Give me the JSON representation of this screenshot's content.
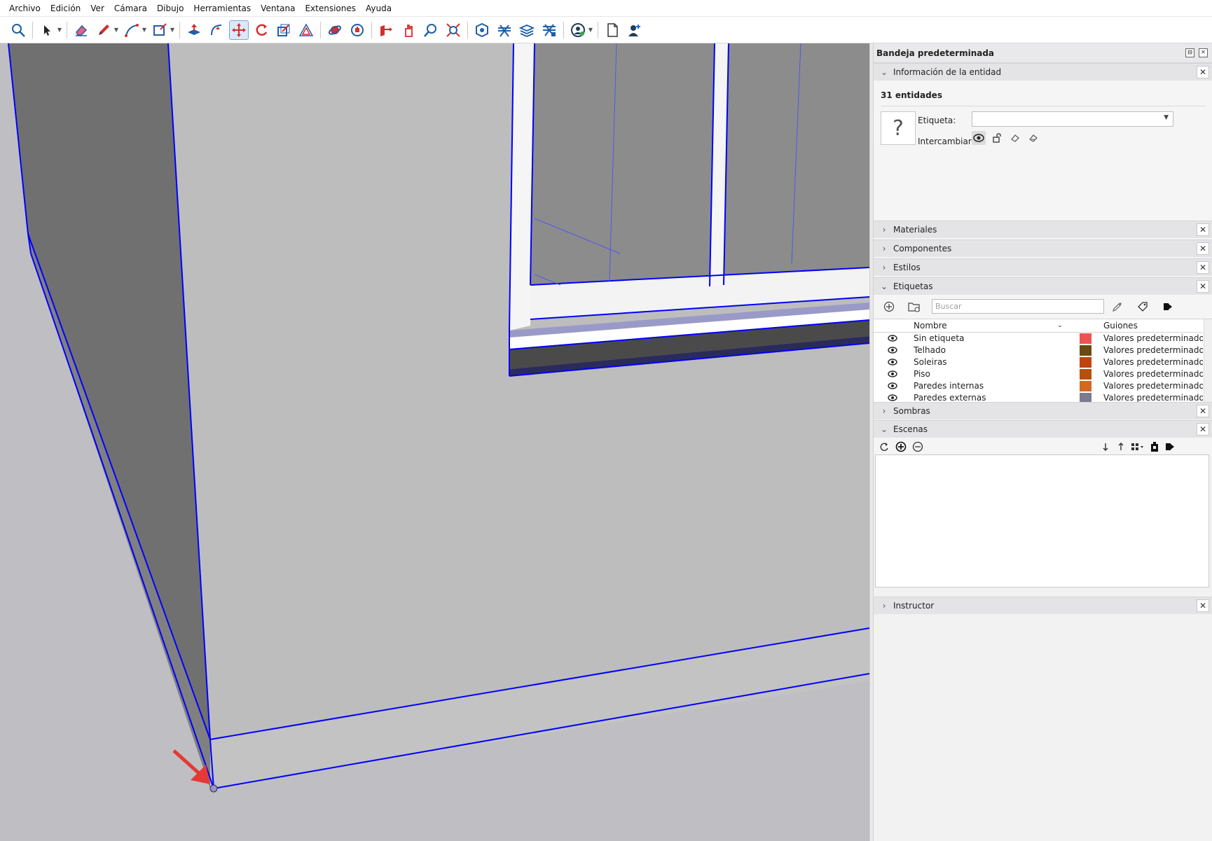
{
  "menu": [
    "Archivo",
    "Edición",
    "Ver",
    "Cámara",
    "Dibujo",
    "Herramientas",
    "Ventana",
    "Extensiones",
    "Ayuda"
  ],
  "toolbar_icons": [
    "search-icon",
    "select-icon",
    "eraser-icon",
    "pencil-icon",
    "arc-icon",
    "rectangle-icon",
    "push-pull-icon",
    "follow-me-icon",
    "move-icon",
    "rotate-icon",
    "scale-icon",
    "offset-icon",
    "orbit-icon",
    "pan-icon",
    "section-plane-icon",
    "walk-icon",
    "zoom-icon",
    "zoom-extents-icon",
    "solid-tools-icon",
    "sandbox-icon",
    "layers-icon",
    "outliner-icon",
    "account-icon",
    "new-document-icon",
    "add-user-icon"
  ],
  "tray": {
    "title": "Bandeja predeterminada",
    "entity_info": {
      "heading": "Información de la entidad",
      "count": "31 entidades",
      "tag_label": "Etiqueta:",
      "tag_value": "",
      "swap_label": "Intercambiar:",
      "thumb_glyph": "?"
    },
    "panels": {
      "materiales": "Materiales",
      "componentes": "Componentes",
      "estilos": "Estilos",
      "etiquetas": "Etiquetas",
      "sombras": "Sombras",
      "escenas": "Escenas",
      "instructor": "Instructor"
    },
    "tags": {
      "search_placeholder": "Buscar",
      "col_name": "Nombre",
      "col_dashes": "Guiones",
      "rows": [
        {
          "name": "Sin etiqueta",
          "color": "#ef5350",
          "dashes": "Valores predeterminados"
        },
        {
          "name": "Telhado",
          "color": "#6b4a10",
          "dashes": "Valores predeterminados"
        },
        {
          "name": "Soleiras",
          "color": "#c1440e",
          "dashes": "Valores predeterminados"
        },
        {
          "name": "Piso",
          "color": "#b5510e",
          "dashes": "Valores predeterminados"
        },
        {
          "name": "Paredes internas",
          "color": "#d2691e",
          "dashes": "Valores predeterminados"
        },
        {
          "name": "Paredes externas",
          "color": "#7a7a90",
          "dashes": "Valores predeterminados"
        }
      ]
    }
  },
  "colors": {
    "selection": "#0000ff",
    "viewport_bg": "#bfbfc3",
    "wall_dark": "#6f6f6f",
    "annotation_arrow": "#e53935"
  }
}
